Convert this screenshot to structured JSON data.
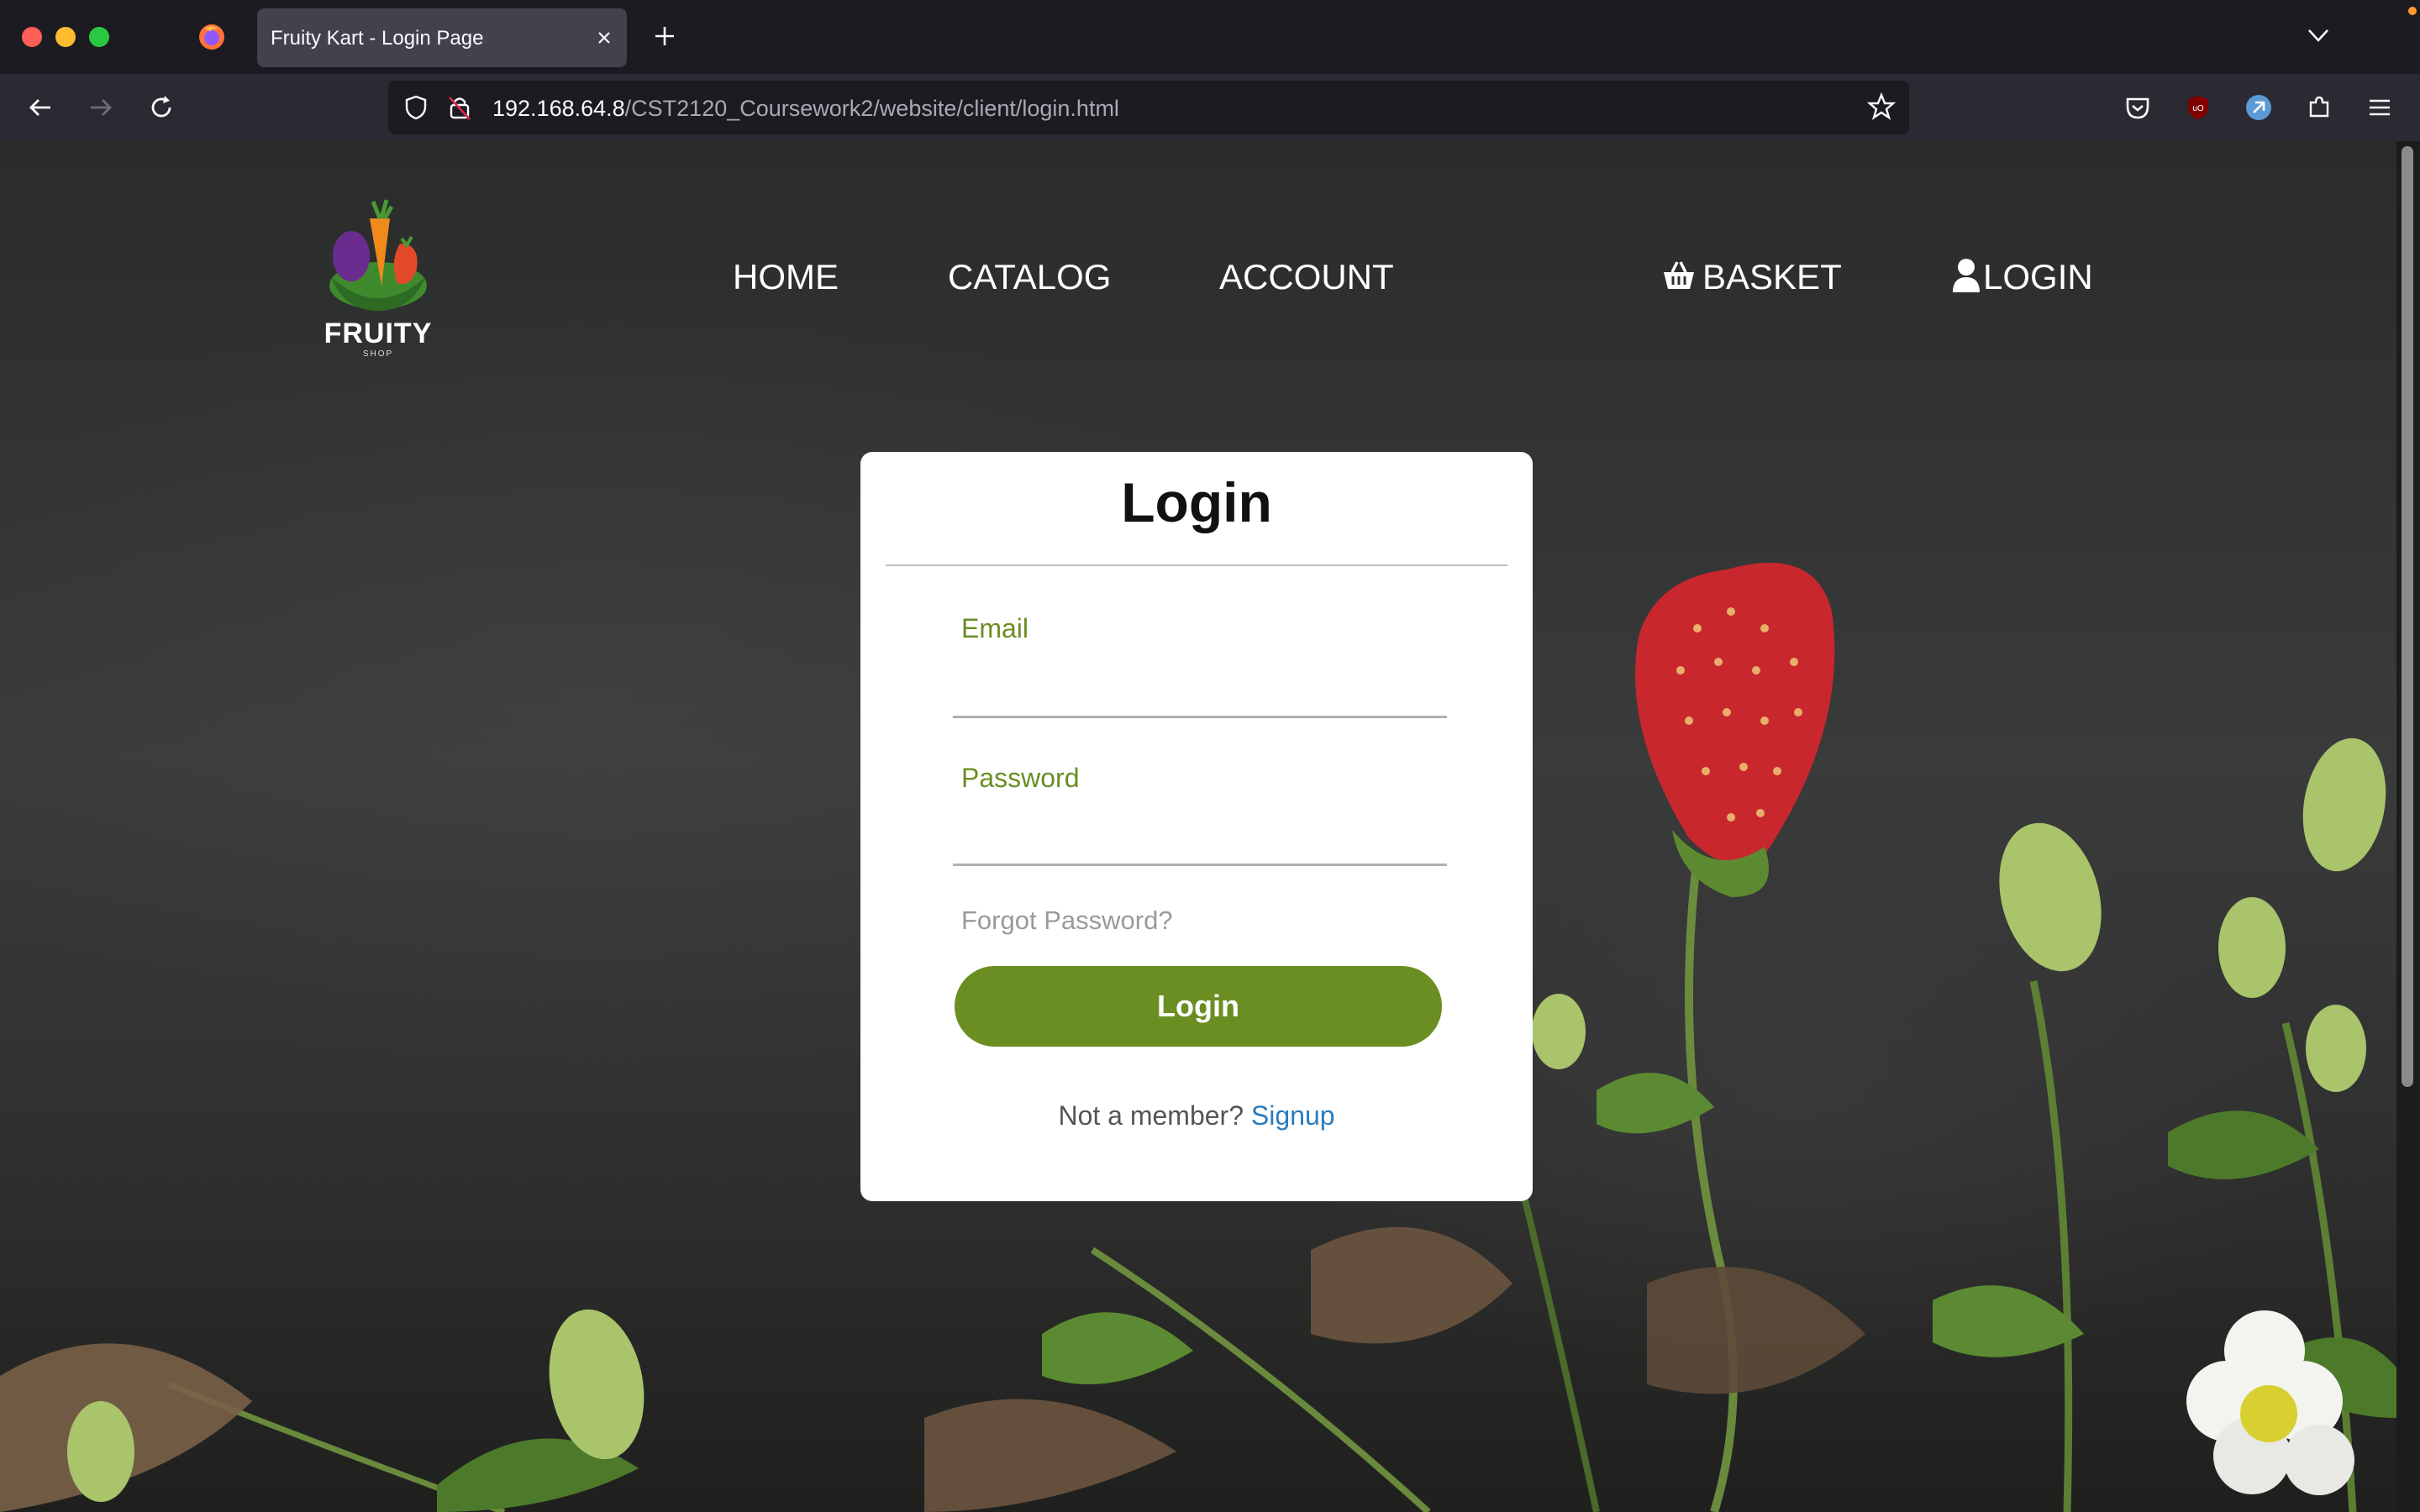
{
  "browser": {
    "tab_title": "Fruity Kart - Login Page",
    "url_host": "192.168.64.8",
    "url_path": "/CST2120_Coursework2/website/client/login.html"
  },
  "header": {
    "logo_text": "FRUITY",
    "logo_subtext": "SHOP",
    "nav": {
      "home": "HOME",
      "catalog": "CATALOG",
      "account": "ACCOUNT",
      "basket": "BASKET",
      "login": "LOGIN"
    }
  },
  "login_form": {
    "title": "Login",
    "email_label": "Email",
    "email_value": "",
    "password_label": "Password",
    "password_value": "",
    "forgot_password": "Forgot Password?",
    "submit_label": "Login",
    "member_prompt": "Not a member?",
    "signup_link": "Signup"
  },
  "colors": {
    "accent_green": "#6b8e23",
    "link_blue": "#2b7bbd",
    "browser_dark": "#1c1b22"
  }
}
